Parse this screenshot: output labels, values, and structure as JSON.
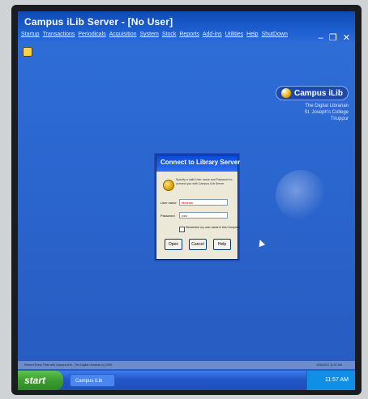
{
  "window": {
    "title": "Campus iLib Server - [No User]",
    "menu": [
      "Startup",
      "Transactions",
      "Periodicals",
      "Acquisition",
      "System",
      "Stock",
      "Reports",
      "Add-ins",
      "Utilities",
      "Help",
      "ShutDown"
    ]
  },
  "brand": {
    "logo": "Campus iLib",
    "line1": "The Digital Librarian",
    "line2": "St. Joseph's College",
    "line3": "Tiruppur"
  },
  "dialog": {
    "title": "Connect to Library Server",
    "prompt": "Specify a valid User name and Password to connect you with Campus iLib Server.",
    "user_label": "User name",
    "user_value": "lib­rarian",
    "password_label": "Password",
    "password_value": "•••••",
    "remember_label": "Remember my user name in this Computer",
    "open": "Open",
    "cancel": "Cancel",
    "help": "Help"
  },
  "statusbar": {
    "left": "Record Every Time with Campus iLib - The Digital Librarian (c) 2009",
    "right": "12/6/2022  11:57 AM"
  },
  "taskbar": {
    "start": "start",
    "task": "Campus iLib",
    "clock": "11:57 AM"
  }
}
